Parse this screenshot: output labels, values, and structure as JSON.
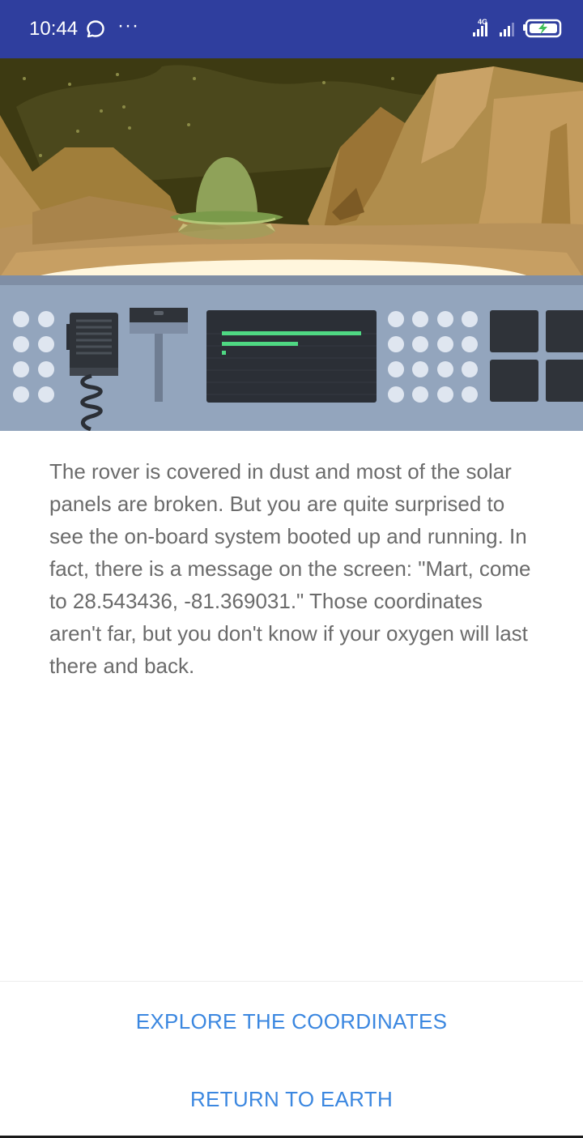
{
  "status_bar": {
    "time": "10:44",
    "network_label": "4G",
    "icons": [
      "chat-bubble-icon",
      "more-dots-icon",
      "cellular-signal-icon",
      "battery-charging-icon"
    ],
    "background_color": "#2f3e9e"
  },
  "hero": {
    "scene": "mars-landscape-with-ufo-and-rover-console",
    "console_screen_lines": 3
  },
  "story": {
    "text": "The rover is covered in dust and most of the solar panels are broken. But you are quite surprised to see the on-board system booted up and running. In fact, there is a message on the screen: \"Mart, come to 28.543436, -81.369031.\" Those coordinates aren't far, but you don't know if your oxygen will last there and back."
  },
  "actions": {
    "explore_label": "EXPLORE THE COORDINATES",
    "return_label": "RETURN TO EARTH",
    "accent_color": "#3b87e0"
  }
}
